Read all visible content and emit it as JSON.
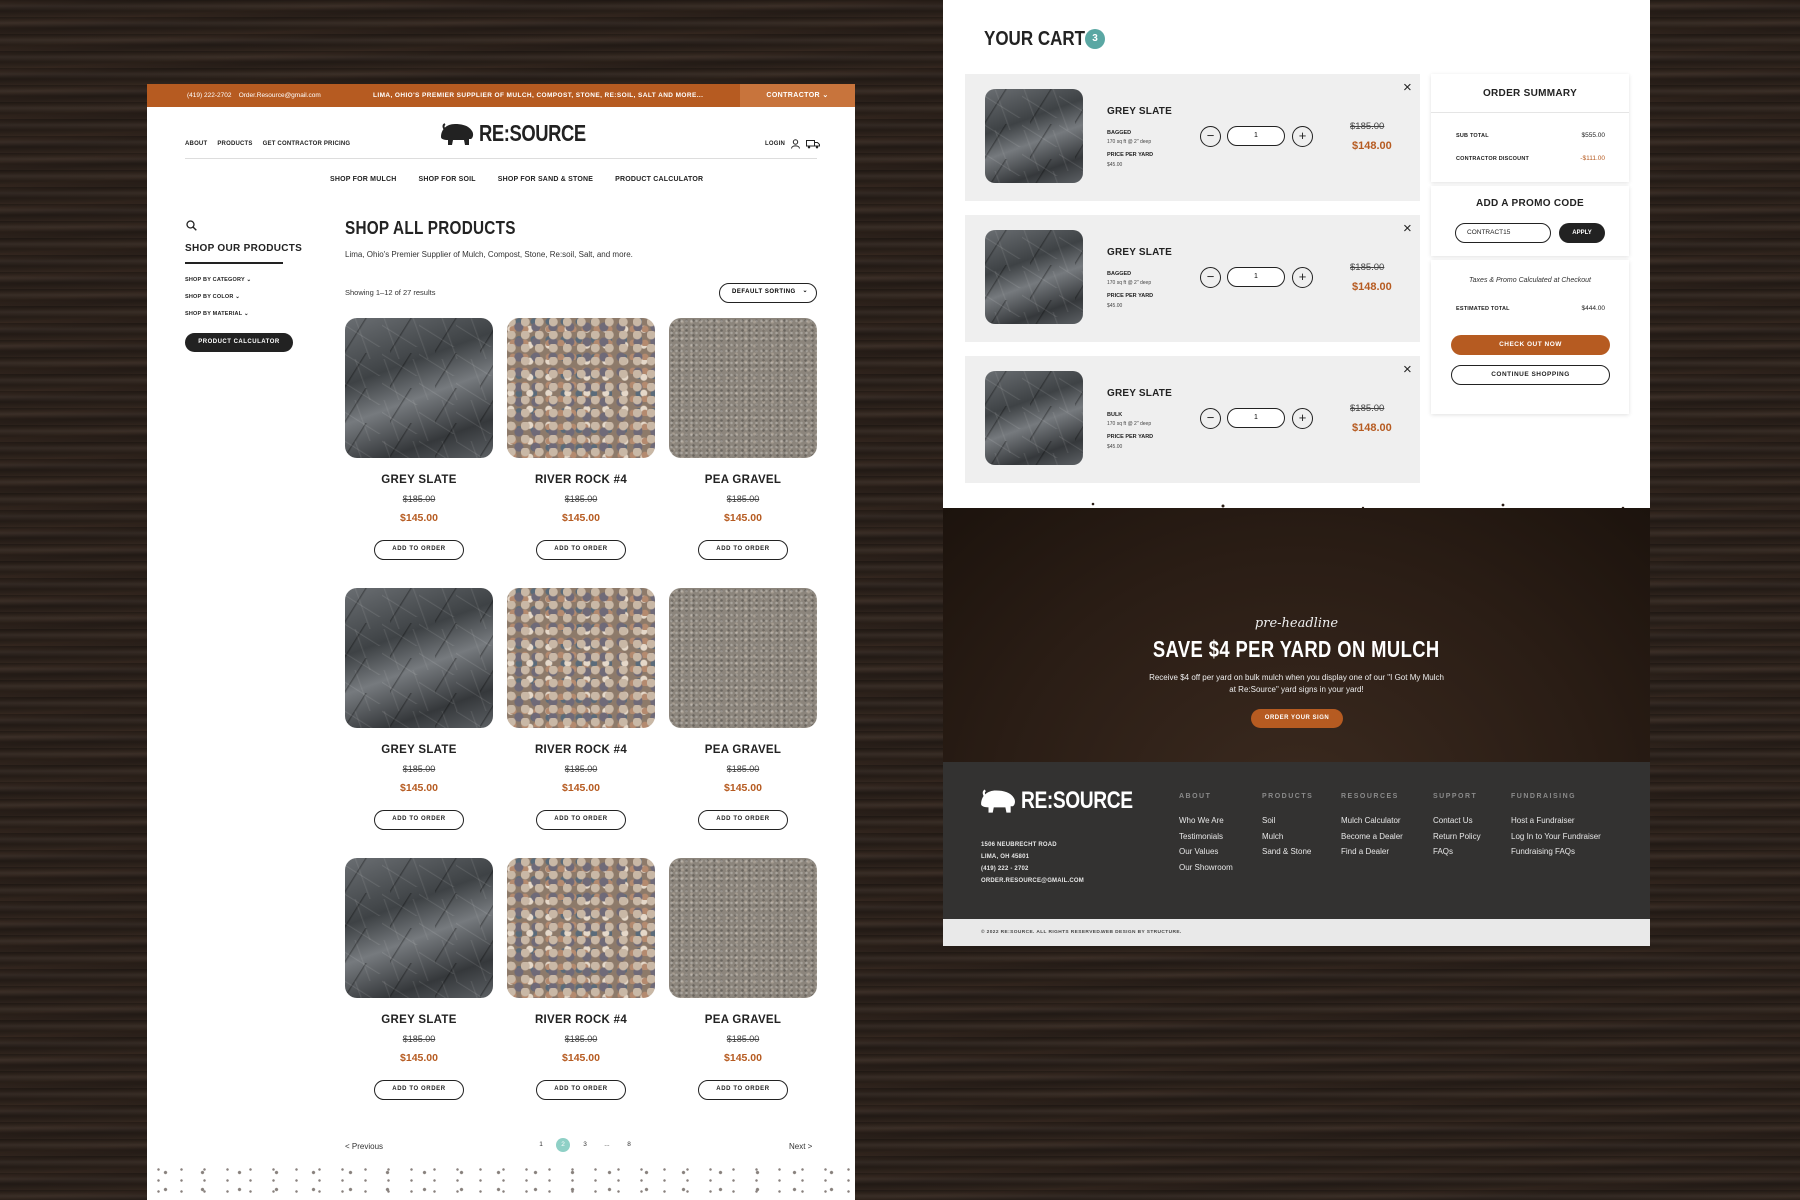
{
  "shop": {
    "topbar": {
      "phone": "(419) 222-2702",
      "email": "Order.Resource@gmail.com",
      "tagline": "LIMA, OHIO'S PREMIER SUPPLIER OF MULCH, COMPOST, STONE, RE:SOIL, SALT AND MORE...",
      "contractor": "CONTRACTOR"
    },
    "logo_text": "RE:SOURCE",
    "nav_left": [
      "ABOUT",
      "PRODUCTS",
      "GET CONTRACTOR PRICING"
    ],
    "nav_right": {
      "login": "LOGIN"
    },
    "subnav": [
      "SHOP FOR MULCH",
      "SHOP FOR SOIL",
      "SHOP FOR SAND & STONE",
      "PRODUCT CALCULATOR"
    ],
    "sidebar": {
      "heading": "SHOP OUR PRODUCTS",
      "filters": [
        "SHOP BY CATEGORY",
        "SHOP BY COLOR",
        "SHOP BY MATERIAL"
      ],
      "calc_button": "PRODUCT CALCULATOR"
    },
    "page_title": "SHOP ALL PRODUCTS",
    "page_subtitle": "Lima, Ohio's Premier Supplier of Mulch, Compost, Stone, Re:soil, Salt, and more.",
    "results": "Showing 1–12 of 27 results",
    "sorting": "DEFAULT SORTING",
    "products": [
      {
        "name": "GREY SLATE",
        "old_price": "$185.00",
        "price": "$145.00",
        "button": "ADD TO ORDER"
      },
      {
        "name": "RIVER ROCK #4",
        "old_price": "$185.00",
        "price": "$145.00",
        "button": "ADD TO ORDER"
      },
      {
        "name": "PEA GRAVEL",
        "old_price": "$185.00",
        "price": "$145.00",
        "button": "ADD TO ORDER"
      },
      {
        "name": "GREY SLATE",
        "old_price": "$185.00",
        "price": "$145.00",
        "button": "ADD TO ORDER"
      },
      {
        "name": "RIVER ROCK #4",
        "old_price": "$185.00",
        "price": "$145.00",
        "button": "ADD TO ORDER"
      },
      {
        "name": "PEA GRAVEL",
        "old_price": "$185.00",
        "price": "$145.00",
        "button": "ADD TO ORDER"
      },
      {
        "name": "GREY SLATE",
        "old_price": "$185.00",
        "price": "$145.00",
        "button": "ADD TO ORDER"
      },
      {
        "name": "RIVER ROCK #4",
        "old_price": "$185.00",
        "price": "$145.00",
        "button": "ADD TO ORDER"
      },
      {
        "name": "PEA GRAVEL",
        "old_price": "$185.00",
        "price": "$145.00",
        "button": "ADD TO ORDER"
      }
    ],
    "pagination": {
      "previous": "< Previous",
      "pages": [
        "1",
        "2",
        "3",
        "...",
        "8"
      ],
      "current_page": "2",
      "next": "Next >"
    }
  },
  "cart": {
    "title": "YOUR CART",
    "count": "3",
    "items": [
      {
        "name": "GREY SLATE",
        "type": "BAGGED",
        "coverage": "170 sq ft @ 2\" deep",
        "price_label": "PRICE PER YARD",
        "unit_price": "$45.00",
        "qty": "1",
        "old_price": "$185.00",
        "price": "$148.00"
      },
      {
        "name": "GREY SLATE",
        "type": "BAGGED",
        "coverage": "170 sq ft @ 2\" deep",
        "price_label": "PRICE PER YARD",
        "unit_price": "$45.00",
        "qty": "1",
        "old_price": "$185.00",
        "price": "$148.00"
      },
      {
        "name": "GREY SLATE",
        "type": "BULK",
        "coverage": "170 sq ft @ 2\" deep",
        "price_label": "PRICE PER YARD",
        "unit_price": "$45.00",
        "qty": "1",
        "old_price": "$185.00",
        "price": "$148.00"
      }
    ],
    "summary": {
      "title": "ORDER SUMMARY",
      "subtotal_label": "SUB TOTAL",
      "subtotal": "$555.00",
      "discount_label": "CONTRACTOR DISCOUNT",
      "discount": "-$111.00",
      "promo_title": "ADD A PROMO CODE",
      "promo_value": "CONTRACT15",
      "apply": "APPLY",
      "taxes_note": "Taxes & Promo Calculated at Checkout",
      "estimated_label": "ESTIMATED TOTAL",
      "estimated": "$444.00",
      "checkout": "CHECK OUT NOW",
      "continue": "CONTINUE SHOPPING"
    },
    "promo_banner": {
      "preheadline": "pre-headline",
      "headline": "SAVE $4 PER YARD ON MULCH",
      "body": "Receive $4 off per yard on bulk mulch when you display one of our \"I Got My Mulch at Re:Source\" yard signs in your yard!",
      "button": "ORDER YOUR SIGN"
    },
    "footer": {
      "logo_text": "RE:SOURCE",
      "address": [
        "1506 NEUBRECHT ROAD",
        "LIMA, OH 45801",
        "(419) 222 - 2702",
        "ORDER.RESOURCE@GMAIL.COM"
      ],
      "columns": [
        {
          "heading": "ABOUT",
          "links": [
            "Who We Are",
            "Testimonials",
            "Our Values",
            "Our Showroom"
          ]
        },
        {
          "heading": "PRODUCTS",
          "links": [
            "Soil",
            "Mulch",
            "Sand & Stone"
          ]
        },
        {
          "heading": "RESOURCES",
          "links": [
            "Mulch Calculator",
            "Become a Dealer",
            "Find a Dealer"
          ]
        },
        {
          "heading": "SUPPORT",
          "links": [
            "Contact Us",
            "Return Policy",
            "FAQs"
          ]
        },
        {
          "heading": "FUNDRAISING",
          "links": [
            "Host a Fundraiser",
            "Log In to Your Fundraiser",
            "Fundraising FAQs"
          ]
        }
      ],
      "copyright": "© 2022 RE:SOURCE. ALL RIGHTS RESERVED.",
      "credit": "WEB DESIGN BY STRUCTURE."
    }
  },
  "colors": {
    "brand_orange": "#b65b21",
    "badge_teal": "#5aa7a3",
    "dark": "#222222",
    "footer_bg": "#333231"
  },
  "icons": [
    "search-icon",
    "user-icon",
    "truck-icon",
    "chevron-down-icon",
    "close-icon",
    "minus-icon",
    "plus-icon",
    "bison-logo-icon"
  ]
}
